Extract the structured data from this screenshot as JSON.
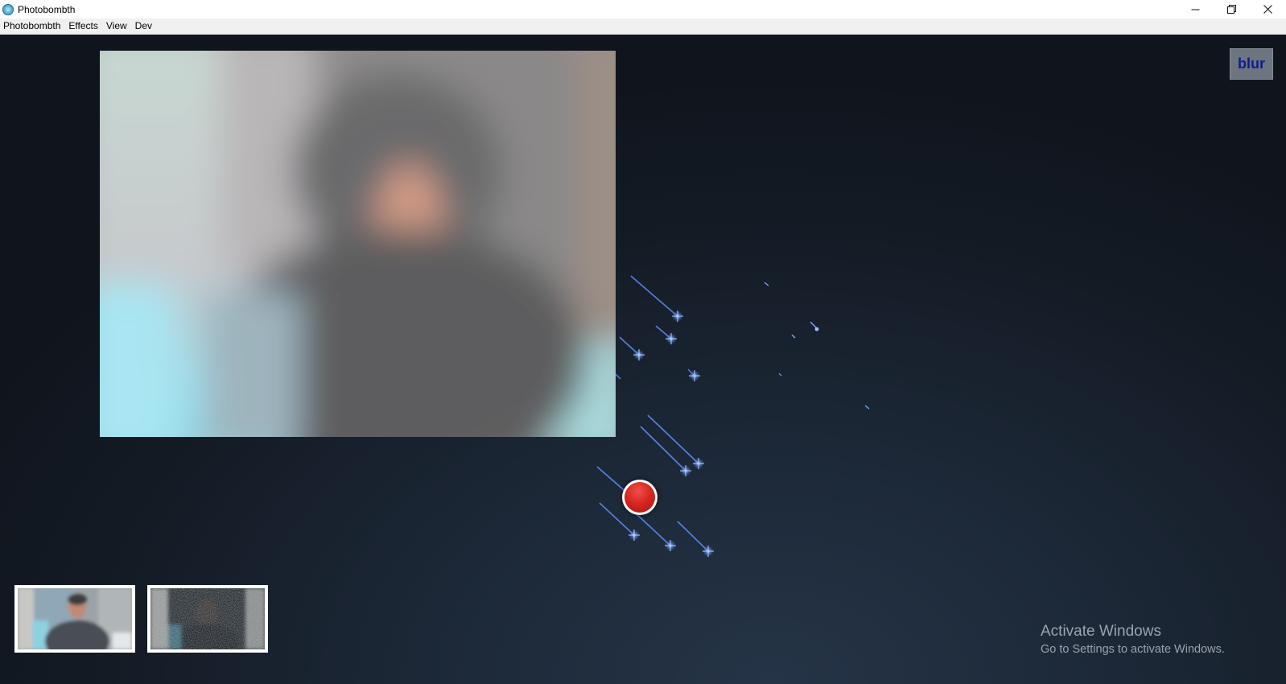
{
  "window": {
    "title": "Photobombth",
    "minimize_icon": "minimize-icon",
    "restore_icon": "restore-icon",
    "close_icon": "close-icon"
  },
  "menu": {
    "items": [
      {
        "label": "Photobombth"
      },
      {
        "label": "Effects"
      },
      {
        "label": "View"
      },
      {
        "label": "Dev"
      }
    ]
  },
  "effect_badge": {
    "label": "blur",
    "text_color": "#0c1e8f"
  },
  "record_button": {
    "icon": "record-icon",
    "color": "#d7281f"
  },
  "thumbnails": [
    {
      "icon": "webcam-photo"
    },
    {
      "icon": "webcam-photo-noise"
    }
  ],
  "watermark": {
    "title": "Activate Windows",
    "subtitle": "Go to Settings to activate Windows."
  },
  "colors": {
    "background": "#1a2330",
    "star": "#6fa0ff"
  }
}
